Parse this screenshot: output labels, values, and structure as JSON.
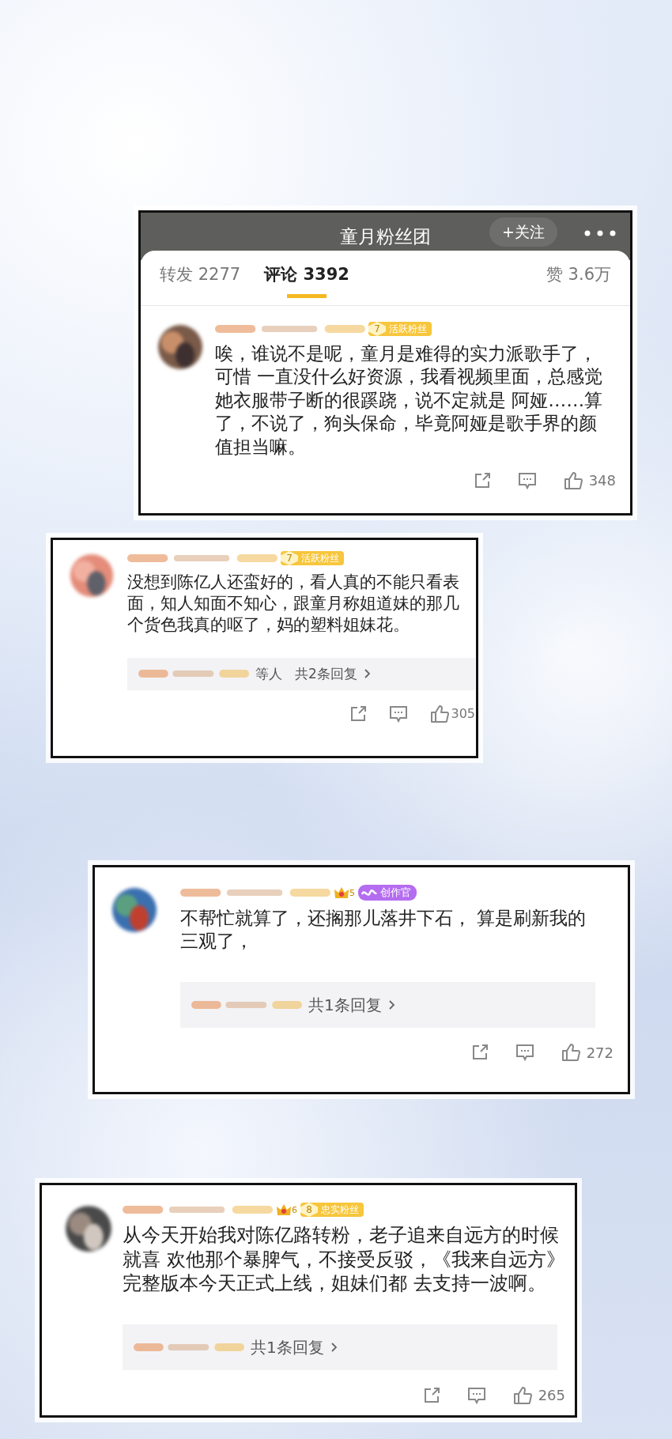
{
  "post": {
    "title": "童月粉丝团",
    "follow_button": "+关注",
    "tabs": [
      {
        "label": "转发 2277",
        "selected": false
      },
      {
        "label": "评论 3392",
        "selected": true
      },
      {
        "label": "赞 3.6万",
        "selected": false
      }
    ]
  },
  "comments": [
    {
      "badge": {
        "kind": "fan",
        "level": "7",
        "label": "活跃粉丝"
      },
      "text": "唉，谁说不是呢，童月是难得的实力派歌手了，可惜 一直没什么好资源，我看视频里面，总感觉她衣服带子断的很蹊跷，说不定就是 阿娅……算了，不说了，狗头保命，毕竟阿娅是歌手界的颜值担当嘛。",
      "likes": "348"
    },
    {
      "badge": {
        "kind": "fan",
        "level": "7",
        "label": "活跃粉丝"
      },
      "text": "没想到陈亿人还蛮好的，看人真的不能只看表面，知人知面不知心，跟童月称姐道妹的那几个货色我真的呕了，妈的塑料姐妹花。",
      "reply": {
        "others": "等人",
        "summary": "共2条回复"
      },
      "likes": "305"
    },
    {
      "rank": "5",
      "badge": {
        "kind": "creator",
        "label": "创作官"
      },
      "text": "不帮忙就算了，还搁那儿落井下石， 算是刷新我的三观了，",
      "reply": {
        "summary": "共1条回复"
      },
      "likes": "272"
    },
    {
      "rank": "6",
      "badge": {
        "kind": "fan",
        "level": "8",
        "label": "忠实粉丝"
      },
      "text": "从今天开始我对陈亿路转粉，老子追来自远方的时候就喜 欢他那个暴脾气，不接受反驳，《我来自远方》完整版本今天正式上线，姐妹们都 去支持一波啊。",
      "reply": {
        "summary": "共1条回复"
      },
      "likes": "265"
    }
  ]
}
